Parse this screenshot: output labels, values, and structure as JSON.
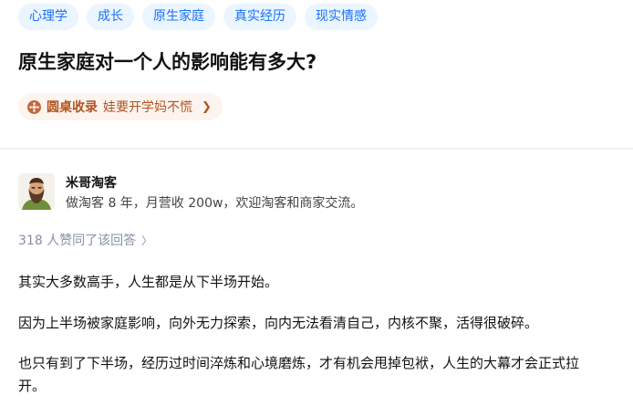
{
  "question": {
    "topics": [
      "心理学",
      "成长",
      "原生家庭",
      "真实经历",
      "现实情感"
    ],
    "title": "原生家庭对一个人的影响能有多大?"
  },
  "circle": {
    "icon": "circle-icon",
    "name": "圆桌收录",
    "subtitle": "娃要开学妈不慌",
    "arrow": "❯",
    "color": "#b15420"
  },
  "author": {
    "name": "米哥淘客",
    "bio": "做淘客 8 年，月营收 200w，欢迎淘客和商家交流。"
  },
  "answer": {
    "vote_text": "318 人赞同了该回答",
    "paragraphs": [
      "其实大多数高手，人生都是从下半场开始。",
      "因为上半场被家庭影响，向外无力探索，向内无法看清自己，内核不聚，活得很破碎。",
      "也只有到了下半场，经历过时间淬炼和心境磨炼，才有机会甩掉包袱，人生的大幕才会正式拉开。"
    ]
  },
  "colors": {
    "accent": "#1772f6",
    "topic_bg": "#ebf5ff",
    "muted": "#8590a6"
  }
}
